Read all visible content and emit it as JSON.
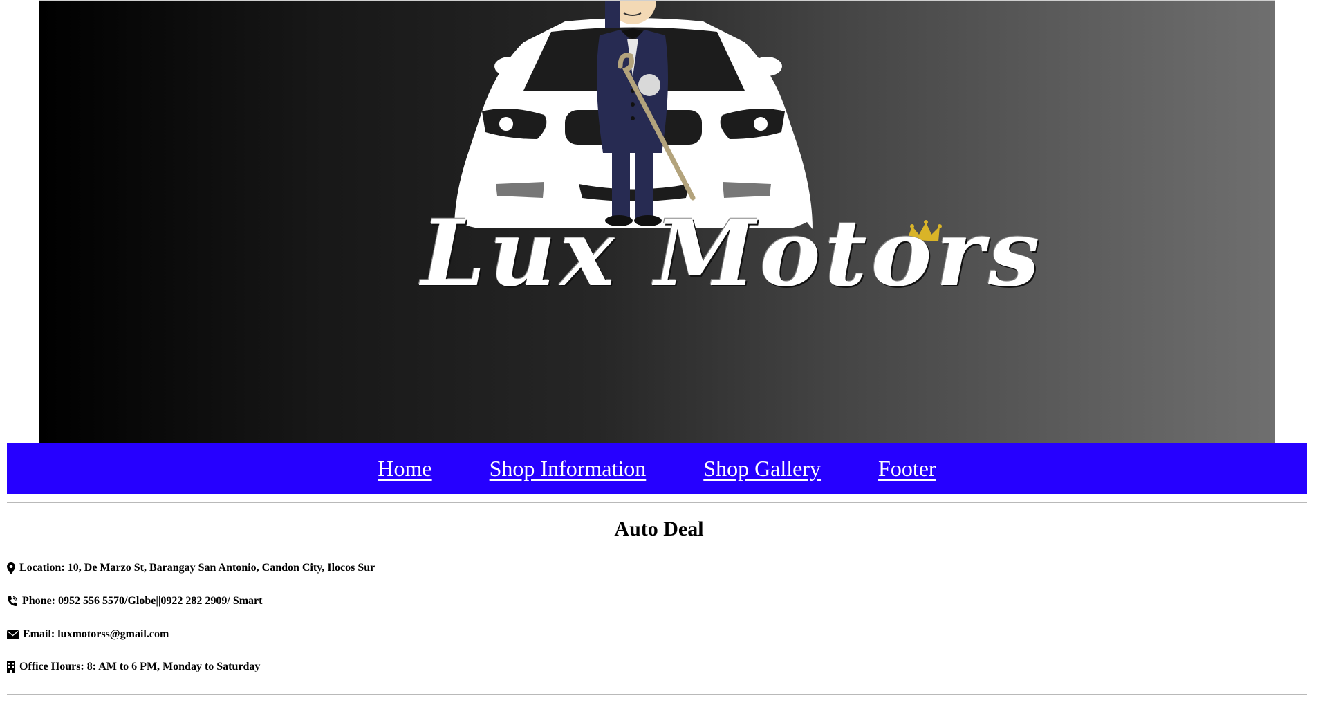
{
  "hero": {
    "brand": "Lux Motors"
  },
  "nav": {
    "items": [
      {
        "label": "Home"
      },
      {
        "label": "Shop Information"
      },
      {
        "label": "Shop Gallery"
      },
      {
        "label": "Footer"
      }
    ],
    "background": "#2600ff"
  },
  "shop": {
    "title": "Auto Deal",
    "location": "Location: 10, De Marzo St, Barangay San Antonio, Candon City, Ilocos Sur",
    "phone": "Phone: 0952 556 5570/Globe||0922 282 2909/ Smart",
    "email": "Email: luxmotorss@gmail.com",
    "hours": "Office Hours: 8: AM to 6 PM, Monday to Saturday",
    "icons": [
      "map-marker-icon",
      "phone-icon",
      "envelope-icon",
      "building-icon"
    ]
  }
}
